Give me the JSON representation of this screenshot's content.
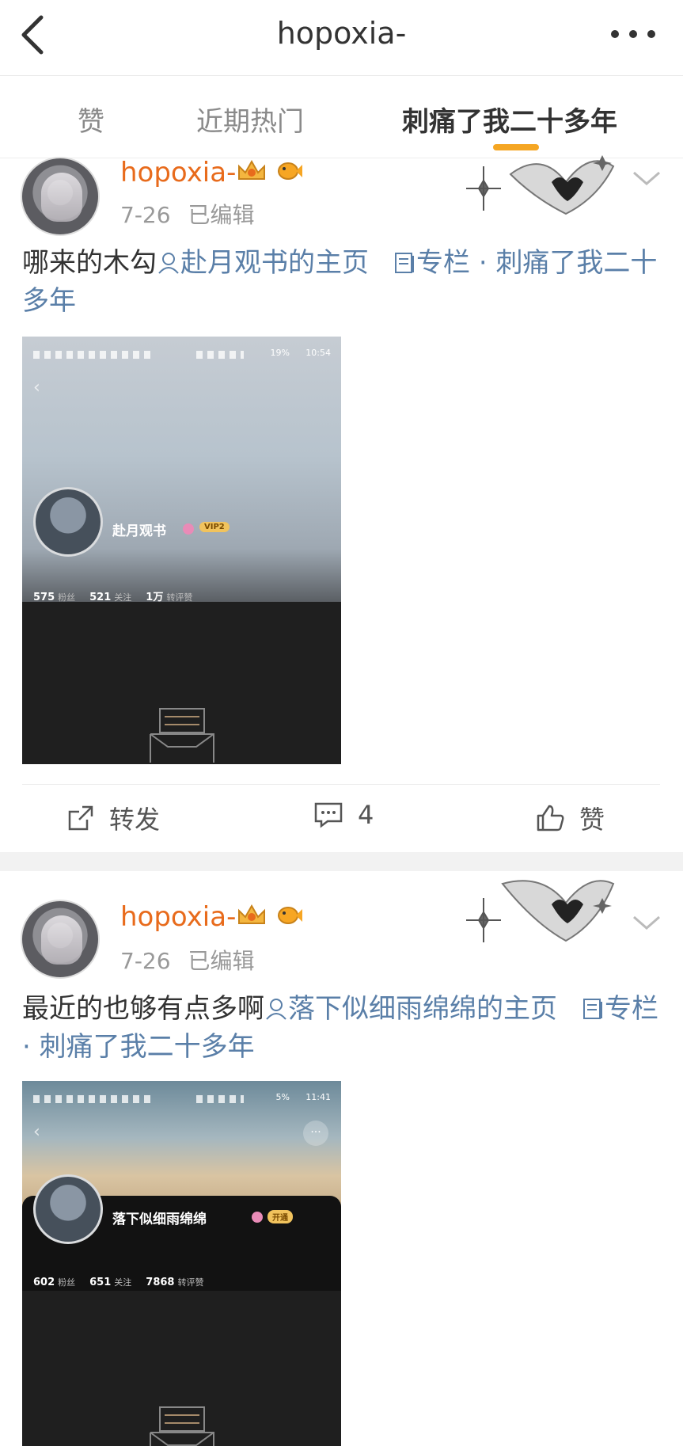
{
  "header": {
    "title": "hopoxia-"
  },
  "tabs": [
    {
      "label": "赞"
    },
    {
      "label": "近期热门"
    },
    {
      "label": "刺痛了我二十多年"
    }
  ],
  "active_tab_index": 2,
  "accent_color": "#f5a623",
  "username_color": "#e86b1c",
  "link_color": "#5a7fa8",
  "posts": [
    {
      "username": "hopoxia-",
      "date": "7-26",
      "edited": "已编辑",
      "text_prefix": "哪来的木勾",
      "mention_link": "赴月观书的主页",
      "column_link": "专栏",
      "column_sep": "·",
      "column_name": "刺痛了我二十多年",
      "thumb": {
        "battery": "19%",
        "time": "10:54",
        "profile_name": "赴月观书",
        "badge": "VIP2",
        "stats": [
          {
            "value": "575",
            "label": "粉丝"
          },
          {
            "value": "521",
            "label": "关注"
          },
          {
            "value": "1万",
            "label": "转评赞"
          }
        ]
      },
      "actions": {
        "repost": "转发",
        "comments": "4",
        "like": "赞"
      }
    },
    {
      "username": "hopoxia-",
      "date": "7-26",
      "edited": "已编辑",
      "text_prefix": "最近的也够有点多啊",
      "mention_link": "落下似细雨绵绵的主页",
      "column_link": "专栏",
      "column_sep": "·",
      "column_name": "刺痛了我二十多年",
      "thumb": {
        "battery": "5%",
        "time": "11:41",
        "profile_name": "落下似细雨绵绵",
        "badge": "开通",
        "stats": [
          {
            "value": "602",
            "label": "粉丝"
          },
          {
            "value": "651",
            "label": "关注"
          },
          {
            "value": "7868",
            "label": "转评赞"
          }
        ]
      }
    }
  ]
}
